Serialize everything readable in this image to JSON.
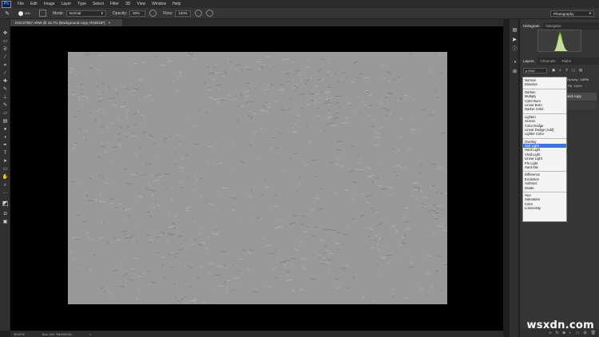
{
  "app": {
    "logo": "Ps"
  },
  "menu": [
    "File",
    "Edit",
    "Image",
    "Layer",
    "Type",
    "Select",
    "Filter",
    "3D",
    "View",
    "Window",
    "Help"
  ],
  "options": {
    "brush_size": "300",
    "mode_label": "Mode:",
    "mode_value": "Normal",
    "opacity_label": "Opacity:",
    "opacity_value": "83%",
    "flow_label": "Flow:",
    "flow_value": "100%",
    "workspace": "Photography"
  },
  "document": {
    "tab_title": "DSC07857.ARW @ 16.7% (Background copy, RGB/16*)",
    "close": "×"
  },
  "status": {
    "zoom": "16.67%",
    "doc_info": "Doc: 201.7M/405.0M",
    "arrow": ">"
  },
  "panels": {
    "top_tabs": [
      "Histogram",
      "Navigator"
    ],
    "layer_tabs": [
      "Layers",
      "Channels",
      "Paths"
    ],
    "kind_label": "ρ Kind",
    "blend_value": "Normal",
    "opacity_label": "Opacity:",
    "opacity_value": "100%",
    "fill_label": "Fill:",
    "fill_value": "100%",
    "layer_name": "Background copy"
  },
  "blend_modes": [
    [
      "Normal",
      "Dissolve"
    ],
    [
      "Darken",
      "Multiply",
      "Color Burn",
      "Linear Burn",
      "Darker Color"
    ],
    [
      "Lighten",
      "Screen",
      "Color Dodge",
      "Linear Dodge (Add)",
      "Lighter Color"
    ],
    [
      "Overlay",
      "Soft Light",
      "Hard Light",
      "Vivid Light",
      "Linear Light",
      "Pin Light",
      "Hard Mix"
    ],
    [
      "Difference",
      "Exclusion",
      "Subtract",
      "Divide"
    ],
    [
      "Hue",
      "Saturation",
      "Color",
      "Luminosity"
    ]
  ],
  "selected_blend_mode": "Soft Light",
  "watermark": "wsxdn.com",
  "colors": {
    "canvas_bg": "#000000",
    "image_gray": "#999999",
    "selection": "#3b78d8",
    "histogram_fill": "#8fd31a"
  }
}
